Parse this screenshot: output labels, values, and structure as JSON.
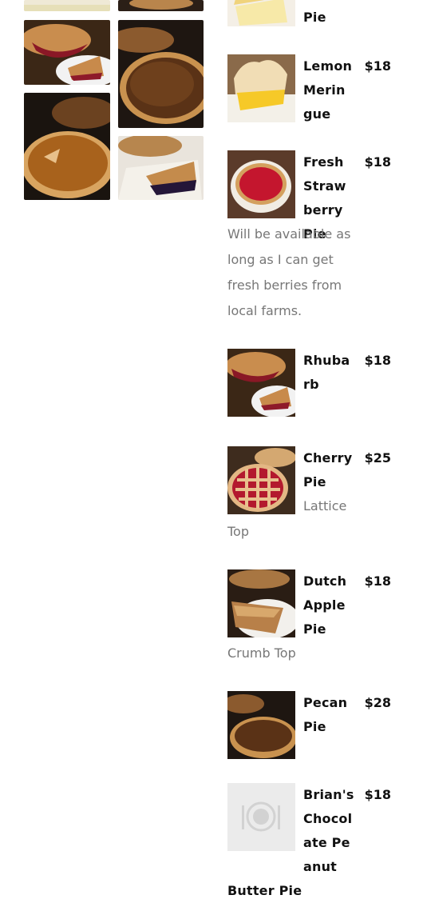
{
  "gallery": {
    "photos": [
      {
        "alt": "lemon pie slice"
      },
      {
        "alt": "pie top"
      },
      {
        "alt": "rhubarb pie slice"
      },
      {
        "alt": "pecan pie"
      },
      {
        "alt": "pumpkin pie"
      },
      {
        "alt": "blueberry pie slice"
      }
    ]
  },
  "menu": {
    "items": [
      {
        "name": "Pie",
        "price": "",
        "description": "",
        "image": "lemon-pie-photo"
      },
      {
        "name": "Lemon Meringue",
        "price": "$18",
        "description": "",
        "image": "lemon-meringue-photo"
      },
      {
        "name": "Fresh Strawberry Pie",
        "price": "$18",
        "description": "Will be available as long as I can get fresh berries from local farms.",
        "image": "strawberry-pie-photo"
      },
      {
        "name": "Rhubarb",
        "price": "$18",
        "description": "",
        "image": "rhubarb-pie-photo"
      },
      {
        "name": "Cherry Pie",
        "price": "$25",
        "description": "Lattice Top",
        "image": "cherry-pie-photo"
      },
      {
        "name": "Dutch Apple Pie",
        "price": "$18",
        "description": "Crumb Top",
        "image": "apple-pie-photo"
      },
      {
        "name": "Pecan Pie",
        "price": "$28",
        "description": "",
        "image": "pecan-pie-photo"
      },
      {
        "name": "Brian's Chocolate Peanut Butter Pie",
        "price": "$18",
        "description": "",
        "image": "plate-placeholder-icon"
      }
    ]
  }
}
